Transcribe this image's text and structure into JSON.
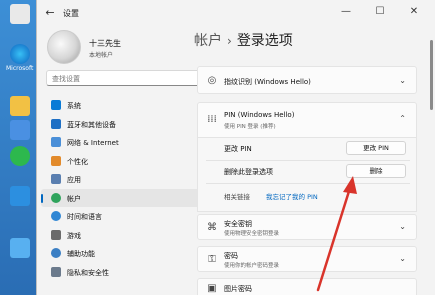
{
  "desktop": {
    "icons": [
      {
        "label": "",
        "color": "#e9e9e9"
      },
      {
        "label": "Microsoft Edge",
        "color": "#1a9be0"
      },
      {
        "label": "",
        "color": "#f2c144"
      },
      {
        "label": "",
        "color": "#4a90e2"
      },
      {
        "label": "",
        "color": "#2db84d"
      },
      {
        "label": "",
        "color": "#2c8fe0"
      },
      {
        "label": "",
        "color": "#58b0f0"
      }
    ]
  },
  "window": {
    "title": "设置",
    "controls": {
      "minimize": "—",
      "maximize": "☐",
      "close": "✕"
    }
  },
  "profile": {
    "name": "十三先生",
    "subtitle": "本地帐户"
  },
  "search": {
    "placeholder": "查找设置"
  },
  "nav": [
    {
      "label": "系统",
      "color": "#0a7bd6",
      "active": false
    },
    {
      "label": "蓝牙和其他设备",
      "color": "#1e6fc4",
      "active": false
    },
    {
      "label": "网络 & Internet",
      "color": "#4a8fd8",
      "active": false
    },
    {
      "label": "个性化",
      "color": "#e28a2b",
      "active": false
    },
    {
      "label": "应用",
      "color": "#5a7fb0",
      "active": false
    },
    {
      "label": "帐户",
      "color": "#2fa35c",
      "active": true
    },
    {
      "label": "时间和语言",
      "color": "#2f86d4",
      "active": false
    },
    {
      "label": "游戏",
      "color": "#6b6b6b",
      "active": false
    },
    {
      "label": "辅助功能",
      "color": "#3b7fc4",
      "active": false
    },
    {
      "label": "隐私和安全性",
      "color": "#6b7a8c",
      "active": false
    }
  ],
  "breadcrumb": {
    "root": "帐户",
    "separator": "›",
    "current": "登录选项"
  },
  "cards": {
    "fingerprint": {
      "title": "指纹识别 (Windows Hello)"
    },
    "pin": {
      "title": "PIN (Windows Hello)",
      "subtitle": "使用 PIN 登录 (推荐)"
    },
    "security_key": {
      "title": "安全密钥",
      "subtitle": "使用物理安全密钥登录"
    },
    "password": {
      "title": "密码",
      "subtitle": "使用你的帐户密码登录"
    },
    "picture": {
      "title": "图片密码"
    }
  },
  "pin_body": {
    "change_label": "更改 PIN",
    "change_button": "更改 PIN",
    "remove_label": "删除此登录选项",
    "remove_button": "删除",
    "related_label": "相关链接",
    "related_link": "我忘记了我的 PIN"
  },
  "colors": {
    "accent": "#0067c0",
    "annotation_arrow": "#d9342b"
  }
}
